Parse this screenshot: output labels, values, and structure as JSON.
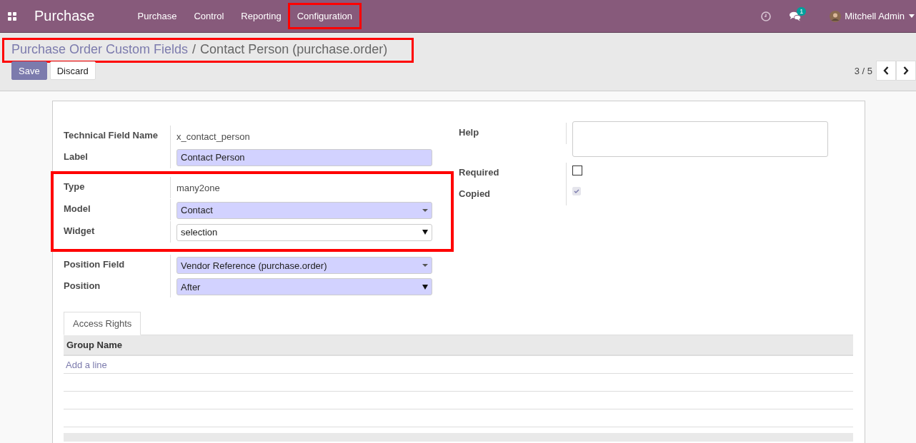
{
  "navbar": {
    "app_title": "Purchase",
    "menu": [
      {
        "label": "Purchase",
        "highlighted": false
      },
      {
        "label": "Control",
        "highlighted": false
      },
      {
        "label": "Reporting",
        "highlighted": false
      },
      {
        "label": "Configuration",
        "highlighted": true
      }
    ],
    "messages_badge": "1",
    "user": "Mitchell Admin"
  },
  "breadcrumb": {
    "parent": "Purchase Order Custom Fields",
    "separator": "/",
    "current": "Contact Person (purchase.order)",
    "highlighted": true
  },
  "buttons": [
    "Save",
    "Discard"
  ],
  "pager": "3 / 5",
  "form": {
    "left_groups": [
      {
        "highlighted": false,
        "fields": [
          {
            "label": "Technical Field Name",
            "kind": "text",
            "value": "x_contact_person"
          },
          {
            "label": "Label",
            "kind": "input",
            "value": "Contact Person"
          }
        ]
      },
      {
        "highlighted": true,
        "fields": [
          {
            "label": "Type",
            "kind": "text",
            "value": "many2one"
          },
          {
            "label": "Model",
            "kind": "many2one",
            "value": "Contact"
          },
          {
            "label": "Widget",
            "kind": "select",
            "value": "selection"
          }
        ]
      },
      {
        "highlighted": false,
        "fields": [
          {
            "label": "Position Field",
            "kind": "many2one",
            "value": "Vendor Reference (purchase.order)"
          },
          {
            "label": "Position",
            "kind": "select-required",
            "value": "After"
          }
        ]
      }
    ],
    "right_fields": [
      {
        "label": "Help",
        "kind": "textarea"
      },
      {
        "label": "Required",
        "kind": "checkbox",
        "checked": false,
        "disabled": false
      },
      {
        "label": "Copied",
        "kind": "checkbox",
        "checked": true,
        "disabled": true
      }
    ]
  },
  "notebook": {
    "tabs": [
      {
        "label": "Access Rights",
        "selected": true
      }
    ],
    "columns": [
      "Group Name"
    ],
    "add_line": "Add a line"
  }
}
